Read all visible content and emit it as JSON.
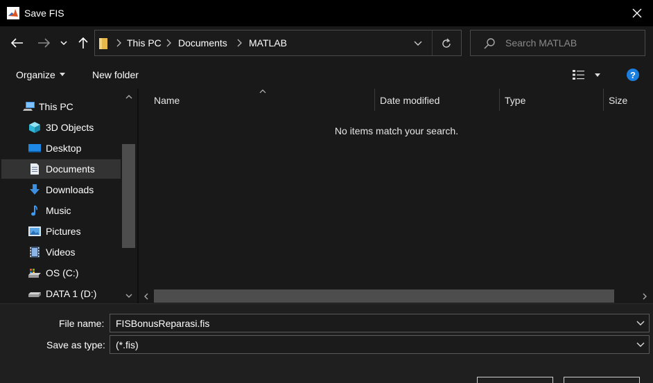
{
  "window": {
    "title": "Save FIS",
    "app_icon": "matlab-icon",
    "close_icon": "close-icon"
  },
  "nav": {
    "back_icon": "back-arrow-icon",
    "forward_icon": "forward-arrow-icon",
    "recent_icon": "chevron-down-icon",
    "up_icon": "up-arrow-icon",
    "breadcrumbs": [
      "This PC",
      "Documents",
      "MATLAB"
    ],
    "search_placeholder": "Search MATLAB"
  },
  "toolbar": {
    "organize_label": "Organize",
    "new_folder_label": "New folder",
    "help_label": "?"
  },
  "sidebar": {
    "items": [
      {
        "label": "This PC",
        "icon": "computer-icon",
        "selected": false
      },
      {
        "label": "3D Objects",
        "icon": "cube-icon",
        "selected": false
      },
      {
        "label": "Desktop",
        "icon": "desktop-icon",
        "selected": false
      },
      {
        "label": "Documents",
        "icon": "document-icon",
        "selected": true
      },
      {
        "label": "Downloads",
        "icon": "download-icon",
        "selected": false
      },
      {
        "label": "Music",
        "icon": "music-note-icon",
        "selected": false
      },
      {
        "label": "Pictures",
        "icon": "picture-icon",
        "selected": false
      },
      {
        "label": "Videos",
        "icon": "film-icon",
        "selected": false
      },
      {
        "label": "OS (C:)",
        "icon": "os-drive-icon",
        "selected": false
      },
      {
        "label": "DATA 1 (D:)",
        "icon": "drive-icon",
        "selected": false
      }
    ]
  },
  "file_list": {
    "columns": [
      "Name",
      "Date modified",
      "Type",
      "Size"
    ],
    "sort_column": "Name",
    "empty_message": "No items match your search."
  },
  "save_form": {
    "file_name_label": "File name:",
    "file_name_value": "FISBonusReparasi.fis",
    "save_type_label": "Save as type:",
    "save_type_value": "(*.fis)"
  },
  "colors": {
    "background": "#191919",
    "accent": "#1b7fe0",
    "selected_item": "#333333"
  }
}
